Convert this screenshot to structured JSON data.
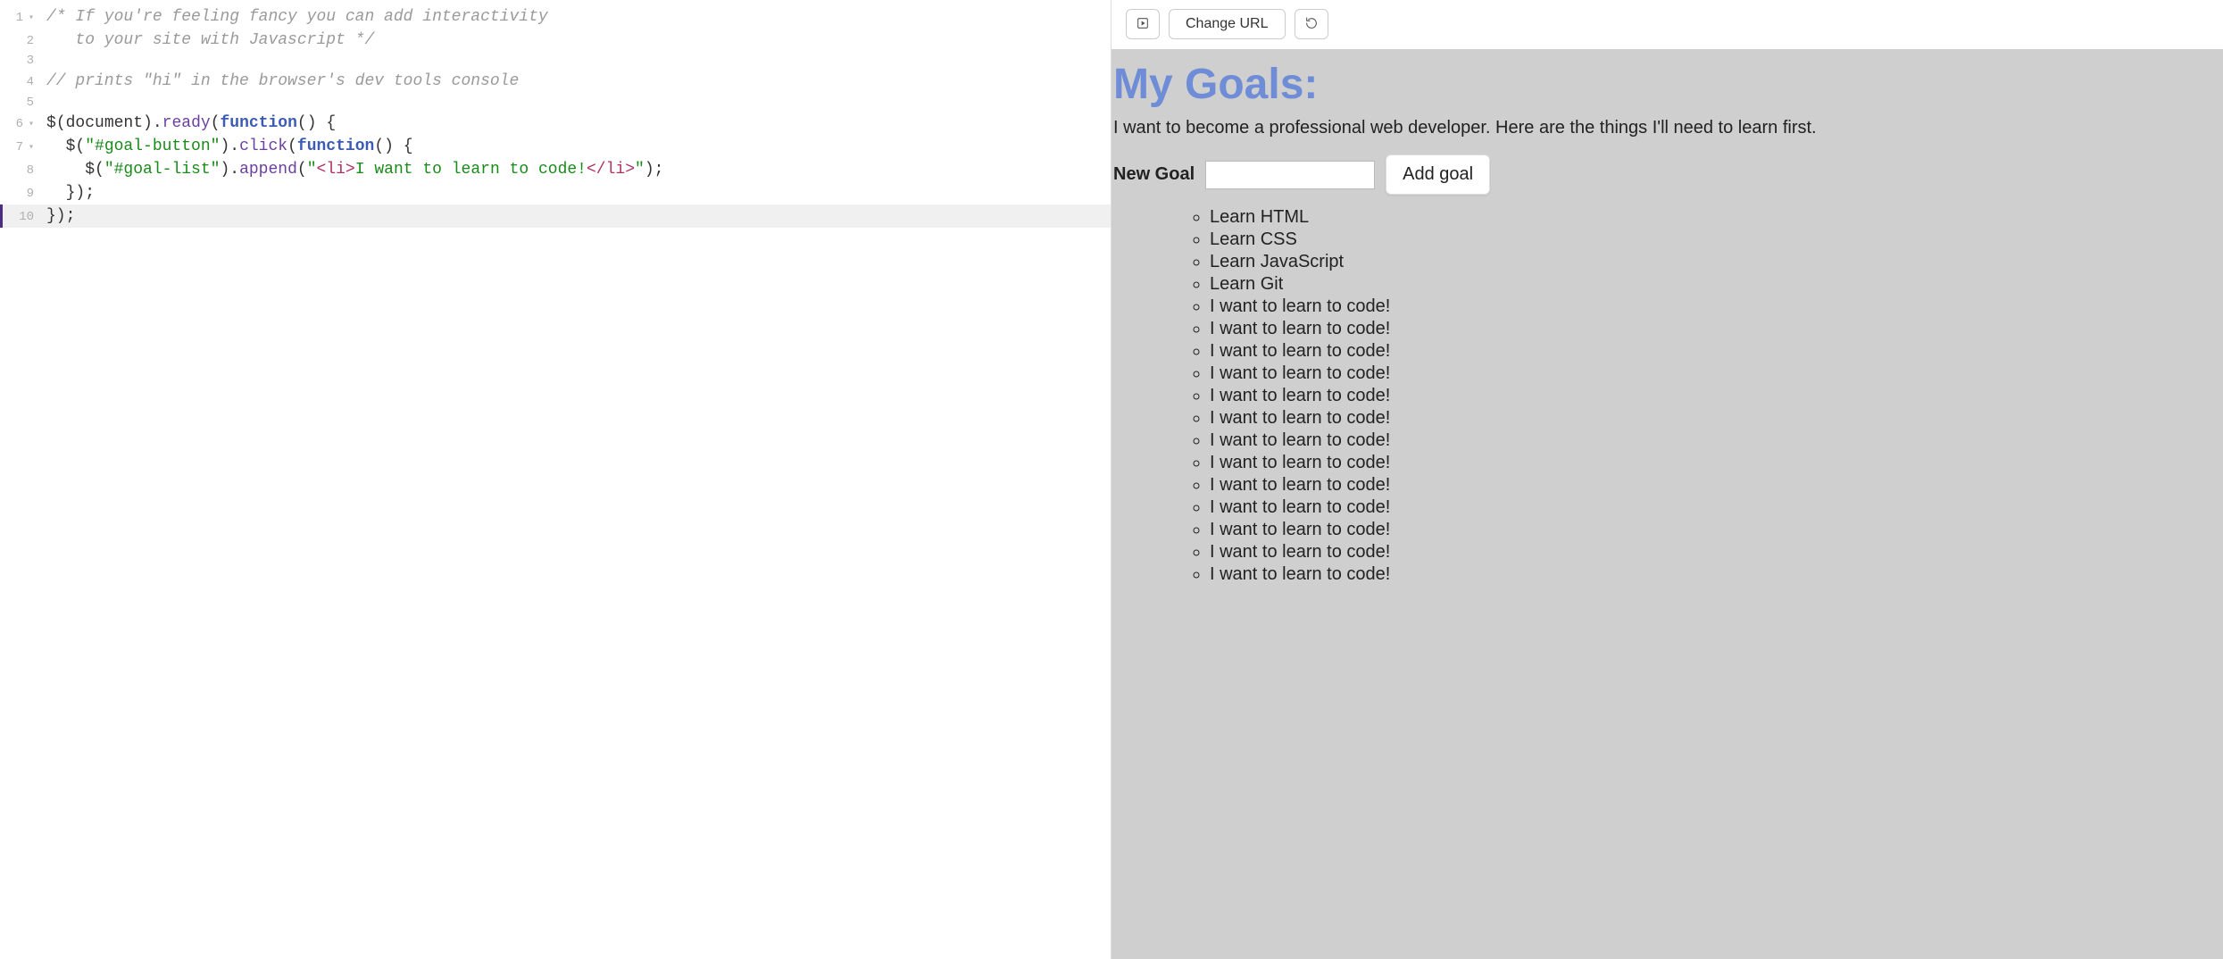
{
  "editor": {
    "lines": [
      {
        "num": "1",
        "fold": true,
        "tokens": [
          {
            "t": "/* If you're feeling fancy you can add interactivity",
            "c": "c-comment"
          }
        ]
      },
      {
        "num": "2",
        "fold": false,
        "tokens": [
          {
            "t": "   to your site with Javascript */",
            "c": "c-comment"
          }
        ]
      },
      {
        "num": "3",
        "fold": false,
        "tokens": []
      },
      {
        "num": "4",
        "fold": false,
        "tokens": [
          {
            "t": "// prints \"hi\" in the browser's dev tools console",
            "c": "c-comment"
          }
        ]
      },
      {
        "num": "5",
        "fold": false,
        "tokens": []
      },
      {
        "num": "6",
        "fold": true,
        "tokens": [
          {
            "t": "$",
            "c": "c-plain"
          },
          {
            "t": "(",
            "c": "c-punc"
          },
          {
            "t": "document",
            "c": "c-plain"
          },
          {
            "t": ")",
            "c": "c-punc"
          },
          {
            "t": ".",
            "c": "c-punc"
          },
          {
            "t": "ready",
            "c": "c-func"
          },
          {
            "t": "(",
            "c": "c-punc"
          },
          {
            "t": "function",
            "c": "c-kw"
          },
          {
            "t": "() {",
            "c": "c-punc"
          }
        ]
      },
      {
        "num": "7",
        "fold": true,
        "tokens": [
          {
            "t": "  $",
            "c": "c-plain"
          },
          {
            "t": "(",
            "c": "c-punc"
          },
          {
            "t": "\"#goal-button\"",
            "c": "c-str"
          },
          {
            "t": ")",
            "c": "c-punc"
          },
          {
            "t": ".",
            "c": "c-punc"
          },
          {
            "t": "click",
            "c": "c-func"
          },
          {
            "t": "(",
            "c": "c-punc"
          },
          {
            "t": "function",
            "c": "c-kw"
          },
          {
            "t": "() {",
            "c": "c-punc"
          }
        ]
      },
      {
        "num": "8",
        "fold": false,
        "tokens": [
          {
            "t": "    $",
            "c": "c-plain"
          },
          {
            "t": "(",
            "c": "c-punc"
          },
          {
            "t": "\"#goal-list\"",
            "c": "c-str"
          },
          {
            "t": ")",
            "c": "c-punc"
          },
          {
            "t": ".",
            "c": "c-punc"
          },
          {
            "t": "append",
            "c": "c-func"
          },
          {
            "t": "(",
            "c": "c-punc"
          },
          {
            "t": "\"",
            "c": "c-str"
          },
          {
            "t": "<li>",
            "c": "c-tag"
          },
          {
            "t": "I want to learn to code!",
            "c": "c-str"
          },
          {
            "t": "</li>",
            "c": "c-tag"
          },
          {
            "t": "\"",
            "c": "c-str"
          },
          {
            "t": ")",
            "c": "c-punc"
          },
          {
            "t": ";",
            "c": "c-punc"
          }
        ]
      },
      {
        "num": "9",
        "fold": false,
        "tokens": [
          {
            "t": "  });",
            "c": "c-punc"
          }
        ]
      },
      {
        "num": "10",
        "fold": false,
        "active": true,
        "tokens": [
          {
            "t": "});",
            "c": "c-punc"
          }
        ]
      }
    ]
  },
  "toolbar": {
    "change_url_label": "Change URL"
  },
  "preview": {
    "title": "My Goals:",
    "subtitle": "I want to become a professional web developer. Here are the things I'll need to learn first.",
    "new_goal_label": "New Goal",
    "new_goal_value": "",
    "add_goal_label": "Add goal",
    "goals": [
      "Learn HTML",
      "Learn CSS",
      "Learn JavaScript",
      "Learn Git",
      "I want to learn to code!",
      "I want to learn to code!",
      "I want to learn to code!",
      "I want to learn to code!",
      "I want to learn to code!",
      "I want to learn to code!",
      "I want to learn to code!",
      "I want to learn to code!",
      "I want to learn to code!",
      "I want to learn to code!",
      "I want to learn to code!",
      "I want to learn to code!",
      "I want to learn to code!"
    ]
  }
}
